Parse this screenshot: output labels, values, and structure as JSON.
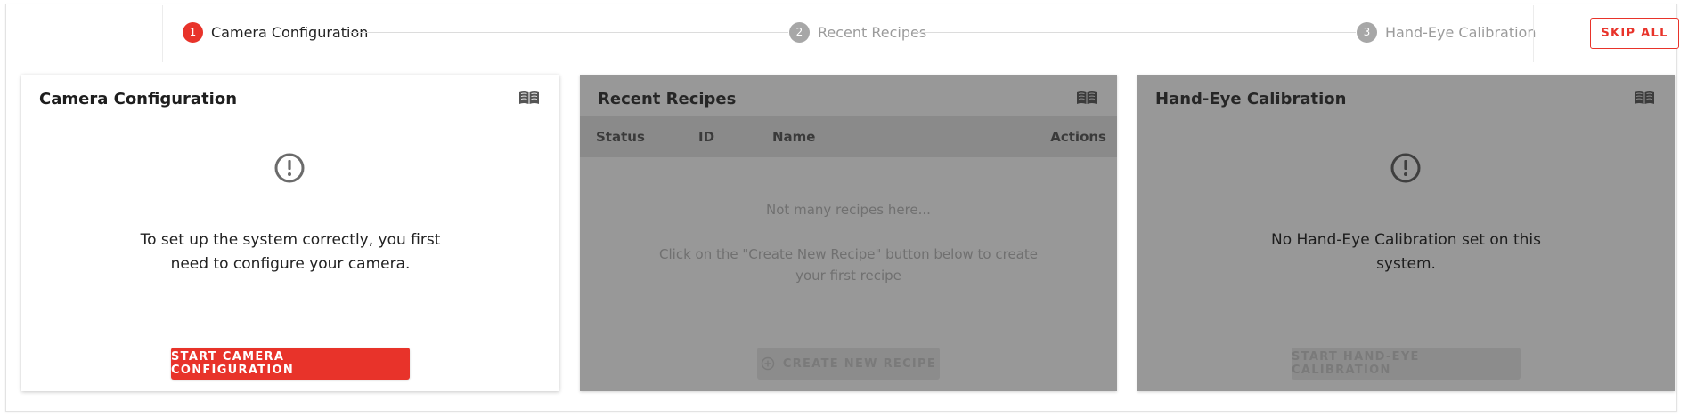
{
  "stepper": {
    "steps": [
      {
        "number": "1",
        "label": "Camera Configuration",
        "state": "active"
      },
      {
        "number": "2",
        "label": "Recent Recipes",
        "state": "inactive"
      },
      {
        "number": "3",
        "label": "Hand-Eye Calibration",
        "state": "inactive"
      }
    ],
    "skip_label": "SKIP ALL"
  },
  "cards": {
    "camera": {
      "title": "Camera Configuration",
      "message_line1": "To set up the system correctly, you first",
      "message_line2": "need to configure your camera.",
      "button_label": "START CAMERA CONFIGURATION",
      "icons": [
        "book-icon",
        "alert-circle-icon"
      ]
    },
    "recipes": {
      "title": "Recent Recipes",
      "columns": [
        "Status",
        "ID",
        "Name",
        "Actions"
      ],
      "empty_title": "Not many recipes here...",
      "empty_hint": "Click on the \"Create New Recipe\" button below to create your first recipe",
      "button_label": "CREATE NEW RECIPE",
      "icons": [
        "book-icon",
        "plus-circle-icon"
      ]
    },
    "handeye": {
      "title": "Hand-Eye Calibration",
      "message_line1": "No Hand-Eye Calibration set on this",
      "message_line2": "system.",
      "button_label": "START HAND-EYE CALIBRATION",
      "icons": [
        "book-icon",
        "alert-circle-icon"
      ]
    }
  },
  "colors": {
    "accent": "#e8332a",
    "disabled_overlay": "#989898",
    "inactive_step": "#a7a7a7"
  }
}
